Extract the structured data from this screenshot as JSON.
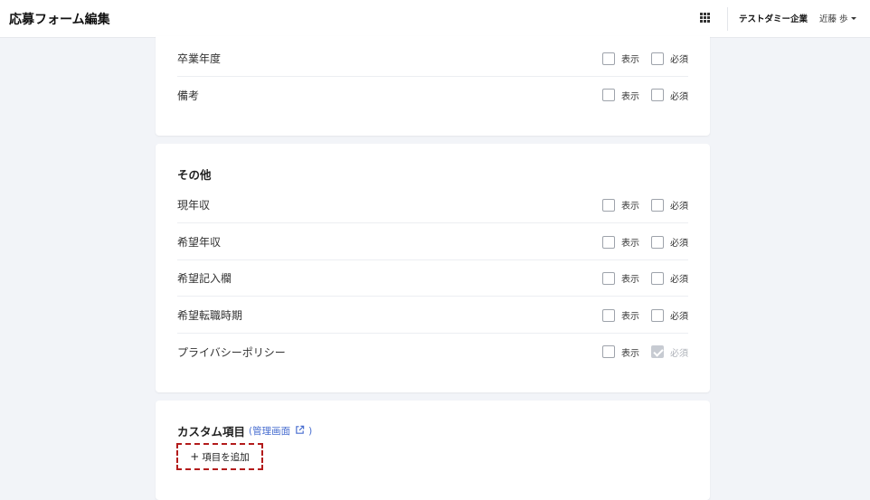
{
  "header": {
    "title": "応募フォーム編集",
    "apps_icon": "grid-apps-icon",
    "company": "テストダミー企業",
    "user": "近藤 歩"
  },
  "options": {
    "display_label": "表示",
    "required_label": "必須"
  },
  "card1": {
    "rows": [
      {
        "label": "卒業年度"
      },
      {
        "label": "備考"
      }
    ]
  },
  "card2": {
    "title": "その他",
    "rows": [
      {
        "label": "現年収"
      },
      {
        "label": "希望年収"
      },
      {
        "label": "希望記入欄"
      },
      {
        "label": "希望転職時期"
      },
      {
        "label": "プライバシーポリシー",
        "required_checked": true,
        "required_disabled": true
      }
    ]
  },
  "custom": {
    "title": "カスタム項目",
    "link_open": "(",
    "link_label": "管理画面",
    "link_close": ")",
    "add_label": "項目を追加"
  },
  "colors": {
    "accent_link": "#4a6fd0",
    "focus_outline": "#b31b1b",
    "background": "#f2f4f8"
  }
}
